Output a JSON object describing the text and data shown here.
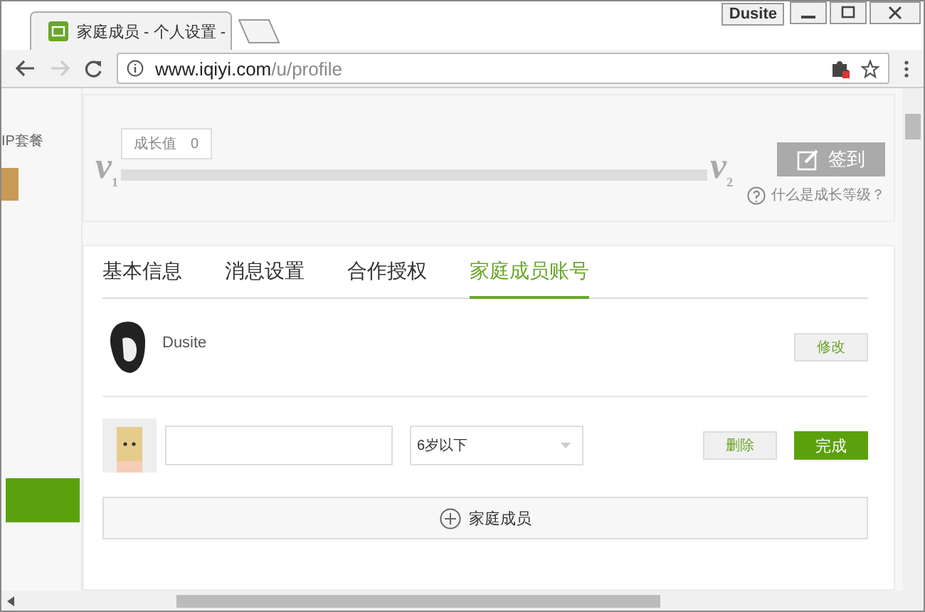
{
  "browser": {
    "tab_title": "家庭成员 - 个人设置 - ",
    "profile_badge": "Dusite",
    "url_host": "www.iqiyi.com",
    "url_path": "/u/profile"
  },
  "sidebar": {
    "vip_label": "IP套餐"
  },
  "growth": {
    "label": "成长值",
    "value": "0",
    "level_from": "v$_{1}$",
    "level_to": "v$_{2}$",
    "level": 0,
    "checkin_button": "签到",
    "help_link": "什么是成长等级？"
  },
  "tabs": [
    {
      "label": "基本信息",
      "selected": false
    },
    {
      "label": "消息设置",
      "selected": false
    },
    {
      "label": "合作授权",
      "selected": false
    },
    {
      "label": "家庭成员账号",
      "selected": true
    }
  ],
  "profile": {
    "name": "Dusite",
    "edit_button": "修改"
  },
  "member_form": {
    "age": "6岁以下",
    "delete_button": "删除",
    "done_button": "完成"
  },
  "add_member_button": "家庭成员"
}
